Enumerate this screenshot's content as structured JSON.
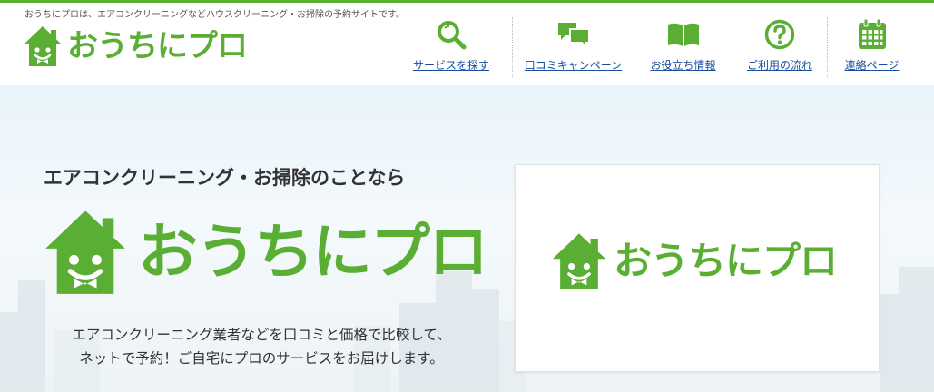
{
  "header": {
    "tagline": "おうちにプロは、エアコンクリーニングなどハウスクリーニング・お掃除の予約サイトです。",
    "logo_text": "おうちにプロ",
    "nav": [
      {
        "label": "サービスを探す",
        "icon": "search-icon"
      },
      {
        "label": "口コミキャンペーン",
        "icon": "chat-bubbles-icon"
      },
      {
        "label": "お役立ち情報",
        "icon": "open-book-icon"
      },
      {
        "label": "ご利用の流れ",
        "icon": "question-circle-icon"
      },
      {
        "label": "連絡ページ",
        "icon": "calendar-icon"
      }
    ]
  },
  "hero": {
    "lead": "エアコンクリーニング・お掃除のことなら",
    "logo_text": "おうちにプロ",
    "description_line1": "エアコンクリーニング業者などを口コミと価格で比較して、",
    "description_line2": "ネットで予約！ご自宅にプロのサービスをお届けします。"
  },
  "card": {
    "logo_text": "おうちにプロ"
  },
  "colors": {
    "brand_green": "#5aae33",
    "link_blue": "#1a4f9c"
  }
}
